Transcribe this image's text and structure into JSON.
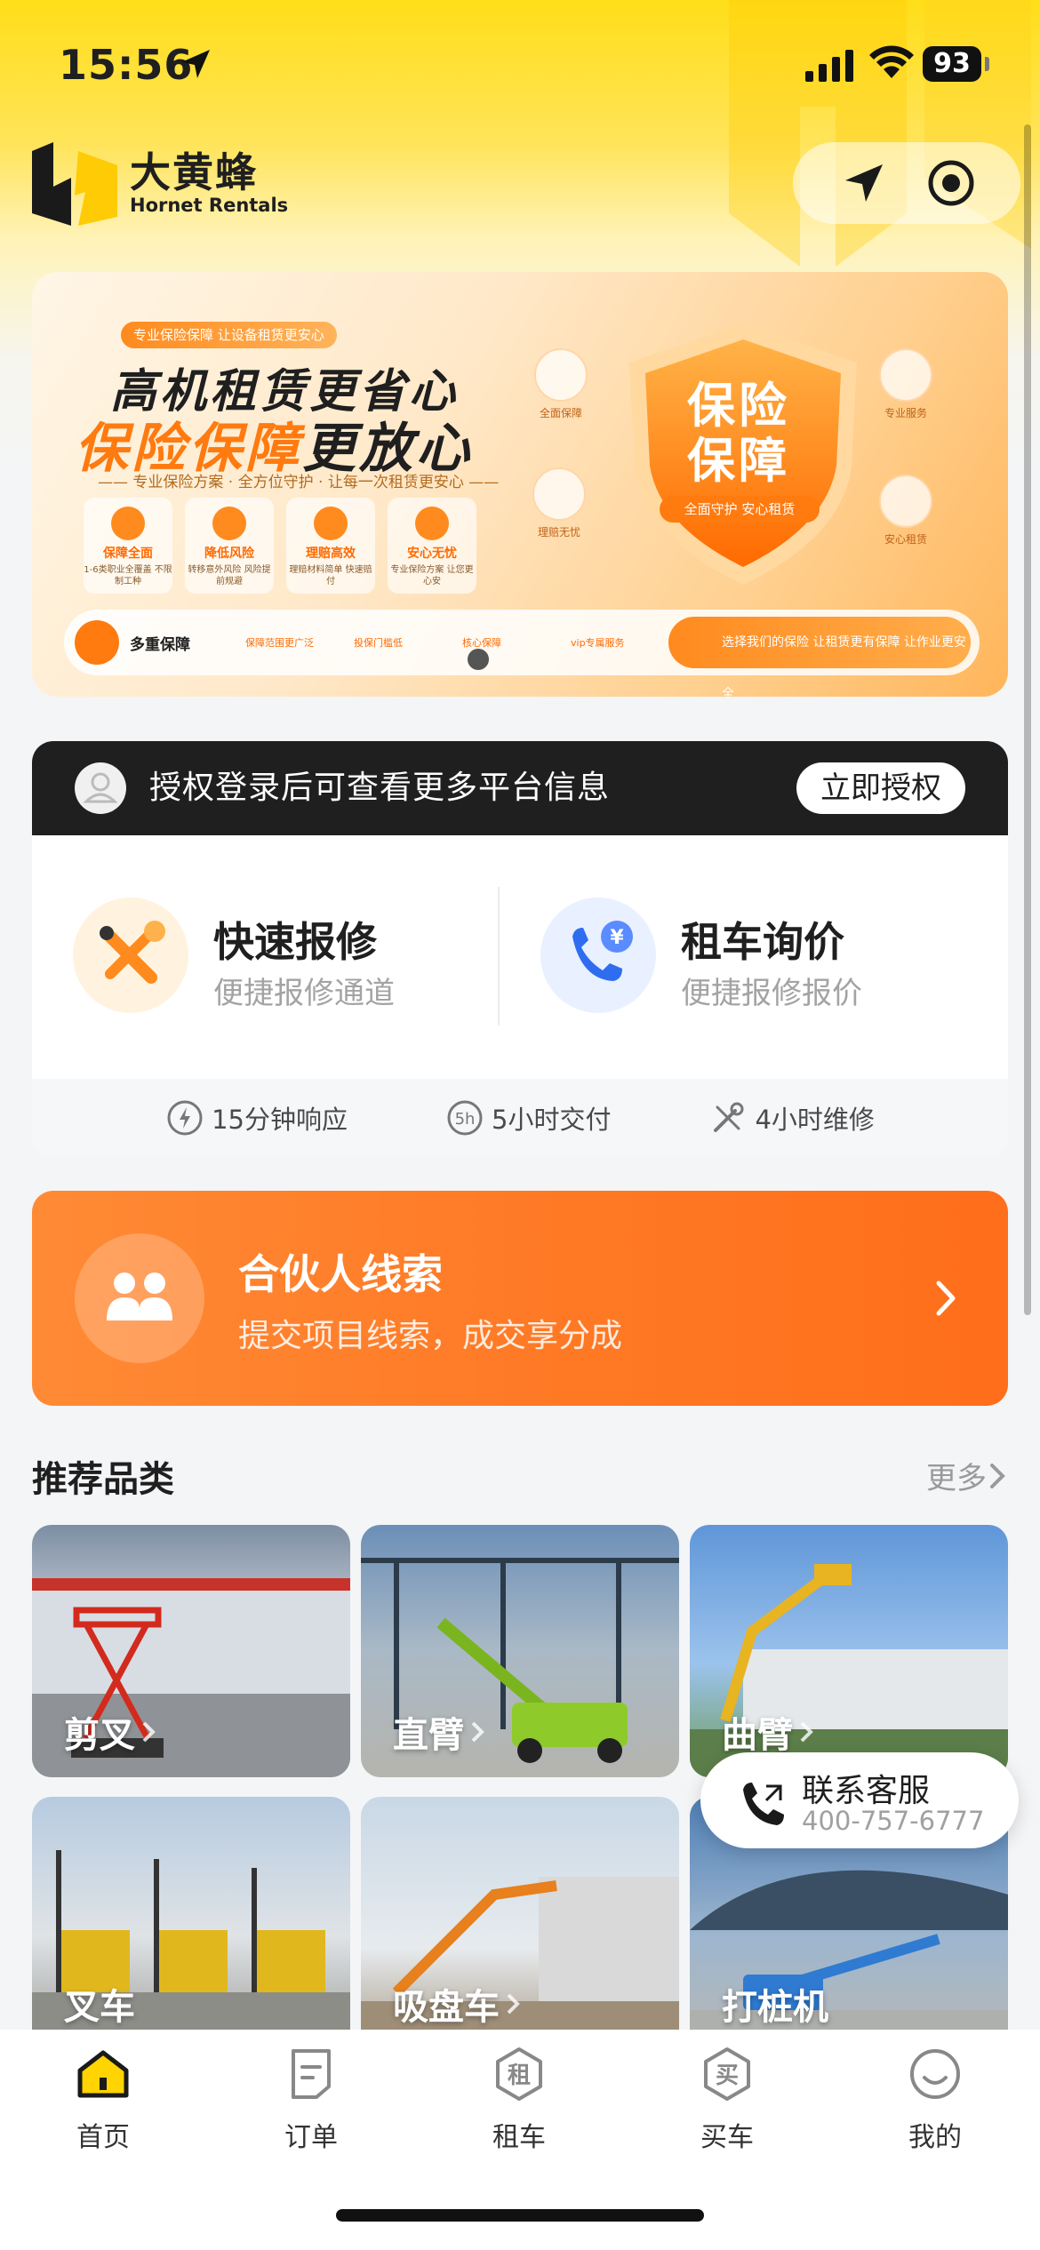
{
  "status_bar": {
    "time": "15:56",
    "battery": "93"
  },
  "header": {
    "logo_cn": "大黄蜂",
    "logo_en": "Hornet Rentals"
  },
  "banner": {
    "tag": "专业保险保障  让设备租赁更安心",
    "title_line1": "高机租赁更省心",
    "title_line2_a": "保险保障",
    "title_line2_b": "更放心",
    "subtitle": "—— 专业保险方案 · 全方位守护 · 让每一次租赁更安心 ——",
    "features": [
      {
        "title": "保障全面",
        "desc": "1-6类职业全覆盖 不限制工种"
      },
      {
        "title": "降低风险",
        "desc": "转移意外风险 风险提前规避"
      },
      {
        "title": "理赔高效",
        "desc": "理赔材料简单 快速赔付"
      },
      {
        "title": "安心无忧",
        "desc": "专业保险方案 让您更心安"
      }
    ],
    "shield_text": "保险保障",
    "shield_caption": "全面守护  安心租赁",
    "side_icons": [
      "全面保障",
      "专业服务",
      "理赔无忧",
      "安心租赁"
    ],
    "bottom_main": "多重保障",
    "bottom_items": [
      "保障范围更广泛",
      "投保门槛低",
      "核心保障",
      "vip专属服务"
    ],
    "bottom_right": "选择我们的保险  让租赁更有保障  让作业更安全"
  },
  "auth": {
    "text": "授权登录后可查看更多平台信息",
    "button": "立即授权"
  },
  "services": [
    {
      "title": "快速报修",
      "subtitle": "便捷报修通道"
    },
    {
      "title": "租车询价",
      "subtitle": "便捷报修报价"
    }
  ],
  "service_features": [
    "15分钟响应",
    "5小时交付",
    "4小时维修"
  ],
  "partner": {
    "title": "合伙人线索",
    "subtitle": "提交项目线索，成交享分成"
  },
  "categories": {
    "heading": "推荐品类",
    "more": "更多",
    "items": [
      {
        "label": "剪叉",
        "color": "#b0361f"
      },
      {
        "label": "直臂",
        "color": "#6e8f2f"
      },
      {
        "label": "曲臂",
        "color": "#e7b422"
      },
      {
        "label": "叉车",
        "color": "#d8b01e"
      },
      {
        "label": "吸盘车",
        "color": "#e88a20"
      },
      {
        "label": "打桩机",
        "color": "#2f7bd2"
      }
    ]
  },
  "customer_service": {
    "title": "联系客服",
    "phone": "400-757-6777"
  },
  "tabs": [
    {
      "label": "首页",
      "icon": "home-icon",
      "active": true
    },
    {
      "label": "订单",
      "icon": "order-icon"
    },
    {
      "label": "租车",
      "icon": "rent-icon",
      "glyph": "租"
    },
    {
      "label": "买车",
      "icon": "buy-icon",
      "glyph": "买"
    },
    {
      "label": "我的",
      "icon": "profile-icon"
    }
  ],
  "colors": {
    "brand_yellow": "#ffde19",
    "accent_orange": "#ff7a26",
    "dark": "#1f1f1f"
  }
}
